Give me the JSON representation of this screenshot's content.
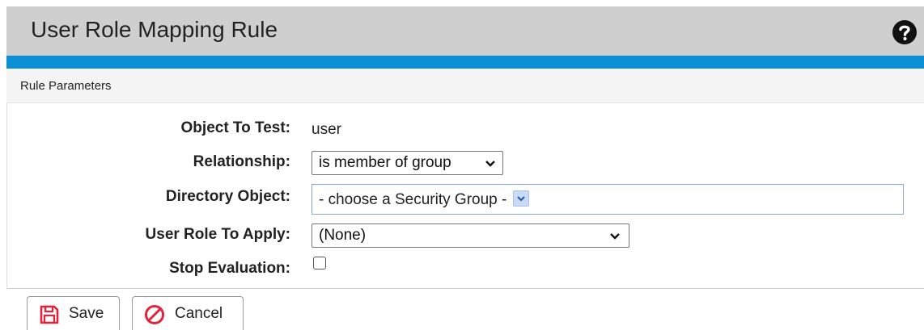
{
  "header": {
    "title": "User Role Mapping Rule",
    "help_icon": "question-circle-icon"
  },
  "section": {
    "title": "Rule Parameters"
  },
  "form": {
    "object_to_test": {
      "label": "Object To Test:",
      "value": "user"
    },
    "relationship": {
      "label": "Relationship:",
      "selected": "is member of group"
    },
    "directory_object": {
      "label": "Directory Object:",
      "selected": "- choose a Security Group -"
    },
    "user_role": {
      "label": "User Role To Apply:",
      "selected": "(None)"
    },
    "stop_evaluation": {
      "label": "Stop Evaluation:",
      "checked": false
    }
  },
  "buttons": {
    "save": {
      "label": "Save",
      "icon": "floppy-disk-icon"
    },
    "cancel": {
      "label": "Cancel",
      "icon": "cancel-circle-icon"
    }
  },
  "colors": {
    "accent": "#0a8fd4",
    "icon_red": "#e2223a",
    "header_bg": "#cfcfcf"
  }
}
